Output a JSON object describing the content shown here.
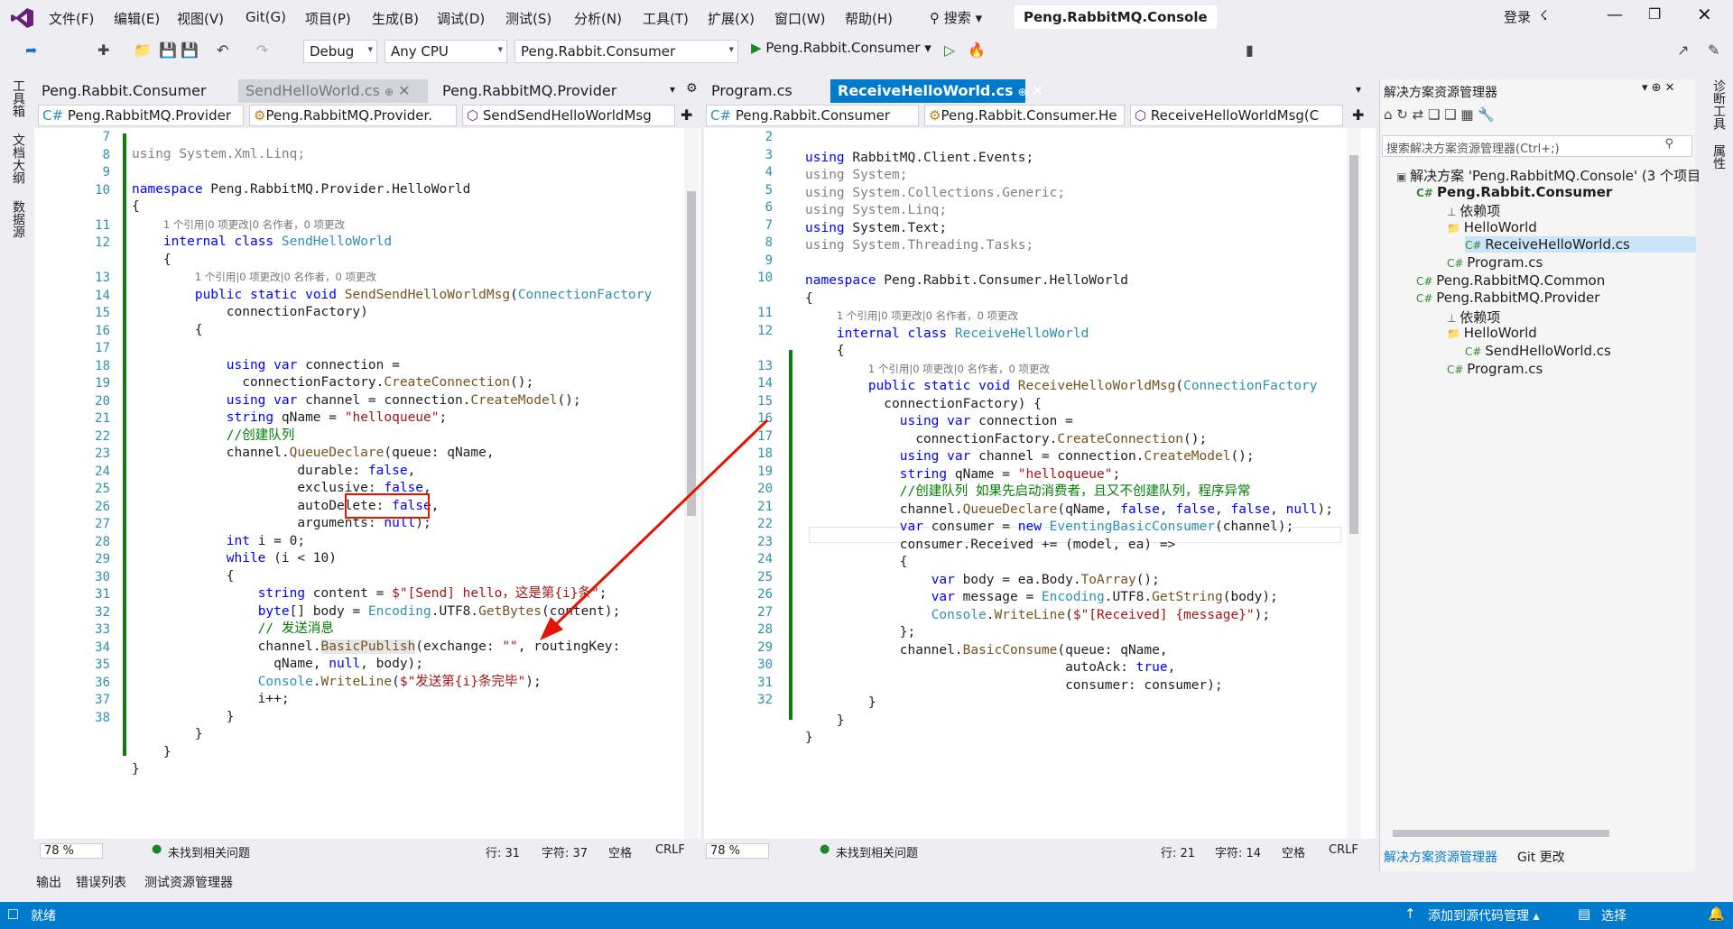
{
  "titlebar": {
    "menu": [
      "文件(F)",
      "编辑(E)",
      "视图(V)",
      "Git(G)",
      "项目(P)",
      "生成(B)",
      "调试(D)",
      "测试(S)",
      "分析(N)",
      "工具(T)",
      "扩展(X)",
      "窗口(W)",
      "帮助(H)"
    ],
    "search": "搜索",
    "solution_title": "Peng.RabbitMQ.Console",
    "login": "登录"
  },
  "toolbar": {
    "config": "Debug",
    "platform": "Any CPU",
    "startup_project": "Peng.Rabbit.Consumer",
    "run_label": "Peng.Rabbit.Consumer"
  },
  "left_sidebar": [
    "工具箱",
    "文档大纲",
    "数据源"
  ],
  "right_sidebar": [
    "诊断工具",
    "属性"
  ],
  "left_pane": {
    "tabs": [
      "Peng.Rabbit.Consumer",
      "SendHelloWorld.cs",
      "Peng.RabbitMQ.Provider"
    ],
    "nav": [
      "Peng.RabbitMQ.Provider",
      "Peng.RabbitMQ.Provider.",
      "SendSendHelloWorldMsg"
    ],
    "lines": [
      "7",
      "8",
      "9",
      "10",
      "11",
      "12",
      "13",
      "14",
      "15",
      "16",
      "17",
      "18",
      "19",
      "20",
      "21",
      "22",
      "23",
      "24",
      "25",
      "26",
      "27",
      "28",
      "29",
      "30",
      "31",
      "32",
      "33",
      "34",
      "35",
      "36",
      "37",
      "38"
    ],
    "lens1": "1 个引用|0 项更改|0 名作者，0 项更改",
    "lens2": "1 个引用|0 项更改|0 名作者，0 项更改",
    "zoom": "78 %",
    "issues": "未找到相关问题",
    "line": "行: 31",
    "col": "字符: 37",
    "ws": "空格",
    "eol": "CRLF"
  },
  "right_pane": {
    "tabs": [
      "Program.cs",
      "ReceiveHelloWorld.cs"
    ],
    "nav": [
      "Peng.Rabbit.Consumer",
      "Peng.Rabbit.Consumer.He",
      "ReceiveHelloWorldMsg(C"
    ],
    "lines": [
      "2",
      "3",
      "4",
      "5",
      "6",
      "7",
      "8",
      "9",
      "10",
      "11",
      "12",
      "13",
      "14",
      "15",
      "16",
      "17",
      "18",
      "19",
      "20",
      "21",
      "22",
      "23",
      "24",
      "25",
      "26",
      "27",
      "28",
      "29",
      "30",
      "31",
      "32"
    ],
    "lens1": "1 个引用|0 项更改|0 名作者，0 项更改",
    "lens2": "1 个引用|0 项更改|0 名作者，0 项更改",
    "zoom": "78 %",
    "issues": "未找到相关问题",
    "line": "行: 21",
    "col": "字符: 14",
    "ws": "空格",
    "eol": "CRLF"
  },
  "solution_explorer": {
    "title": "解决方案资源管理器",
    "search_placeholder": "搜索解决方案资源管理器(Ctrl+;)",
    "items": [
      "解决方案 'Peng.RabbitMQ.Console' (3 个项目",
      "Peng.Rabbit.Consumer",
      "依赖项",
      "HelloWorld",
      "ReceiveHelloWorld.cs",
      "Program.cs",
      "Peng.RabbitMQ.Common",
      "Peng.RabbitMQ.Provider",
      "依赖项",
      "HelloWorld",
      "SendHelloWorld.cs",
      "Program.cs"
    ],
    "bottom_tabs": [
      "解决方案资源管理器",
      "Git 更改"
    ]
  },
  "bottom_tabs": [
    "输出",
    "错误列表",
    "测试资源管理器"
  ],
  "statusbar": {
    "ready": "就绪",
    "source_control": "添加到源代码管理",
    "repo": "选择"
  },
  "colors": {
    "accent": "#007acc",
    "highlight": "#e51400",
    "modified": "#107c10"
  }
}
